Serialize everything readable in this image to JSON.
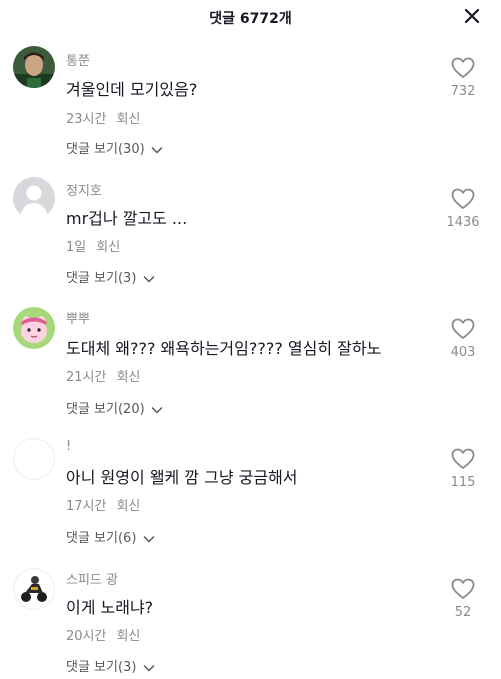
{
  "header": {
    "title": "댓글 6772개"
  },
  "reply_label": "회신",
  "comments": [
    {
      "username": "통쭌",
      "text": "겨울인데 모기있음?",
      "time": "23시간",
      "view_replies": "댓글 보기(30)",
      "likes": "732"
    },
    {
      "username": "정지호",
      "text": "mr겁나 깔고도 ...",
      "time": "1일",
      "view_replies": "댓글 보기(3)",
      "likes": "1436"
    },
    {
      "username": "뿌뿌",
      "text": "도대체 왜??? 왜욕하는거임???? 열심히 잘하노",
      "time": "21시간",
      "view_replies": "댓글 보기(20)",
      "likes": "403"
    },
    {
      "username": "!",
      "text": "아니 원영이 왤케 깜 그냥 궁금해서",
      "time": "17시간",
      "view_replies": "댓글 보기(6)",
      "likes": "115"
    },
    {
      "username": "스피드 광",
      "text": "이게 노래냐?",
      "time": "20시간",
      "view_replies": "댓글 보기(3)",
      "likes": "52"
    }
  ]
}
